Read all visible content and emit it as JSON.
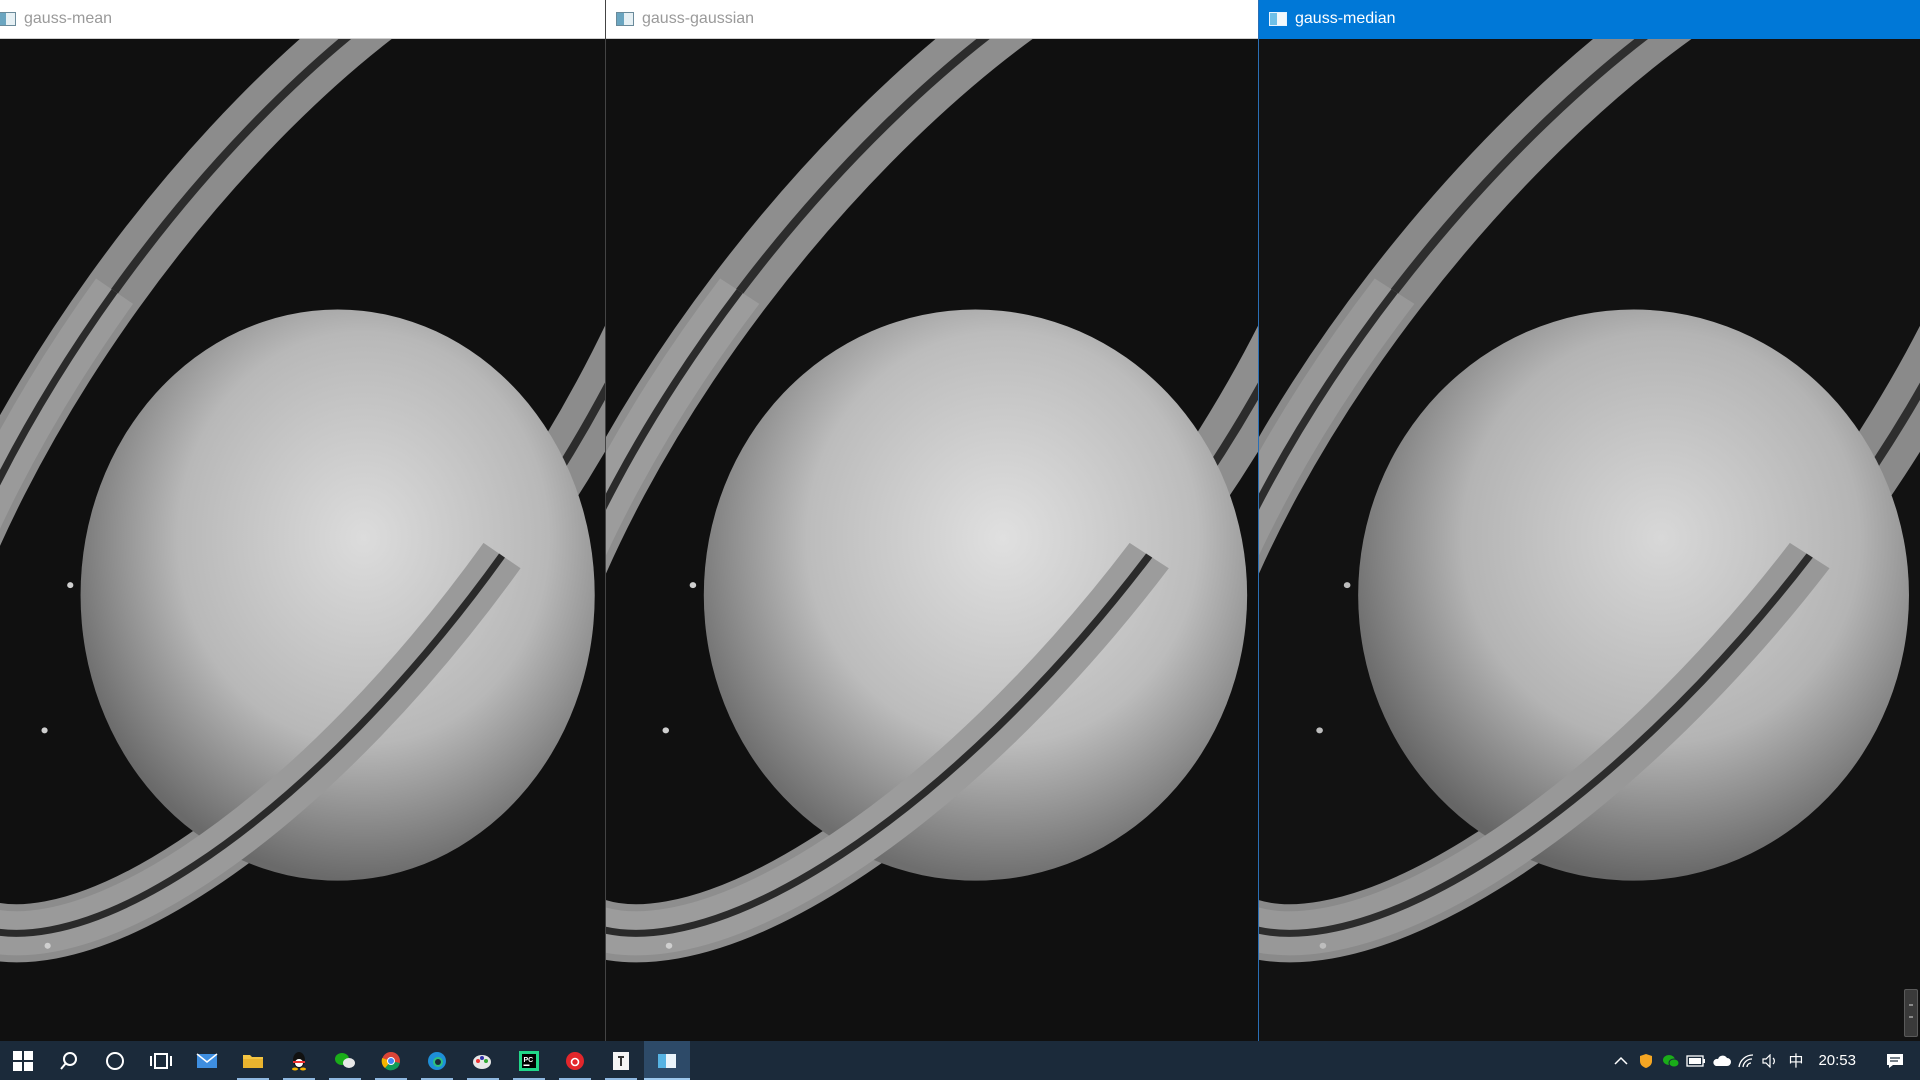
{
  "windows": [
    {
      "title": "gauss-mean",
      "active": false
    },
    {
      "title": "gauss-gaussian",
      "active": false
    },
    {
      "title": "gauss-median",
      "active": true
    }
  ],
  "taskbar": {
    "apps": [
      "start-icon",
      "search-icon",
      "cortana-icon",
      "task-view-icon",
      "mail-icon",
      "file-explorer-icon",
      "qq-icon",
      "wechat-icon",
      "chrome-icon",
      "edge-icon",
      "paint-icon",
      "pycharm-icon",
      "netease-music-icon",
      "typora-icon",
      "opencv-window-icon"
    ],
    "tray": {
      "ime": "中",
      "clock": "20:53"
    }
  },
  "colors": {
    "accent": "#0078d7",
    "taskbar": "#1b2a3a"
  }
}
